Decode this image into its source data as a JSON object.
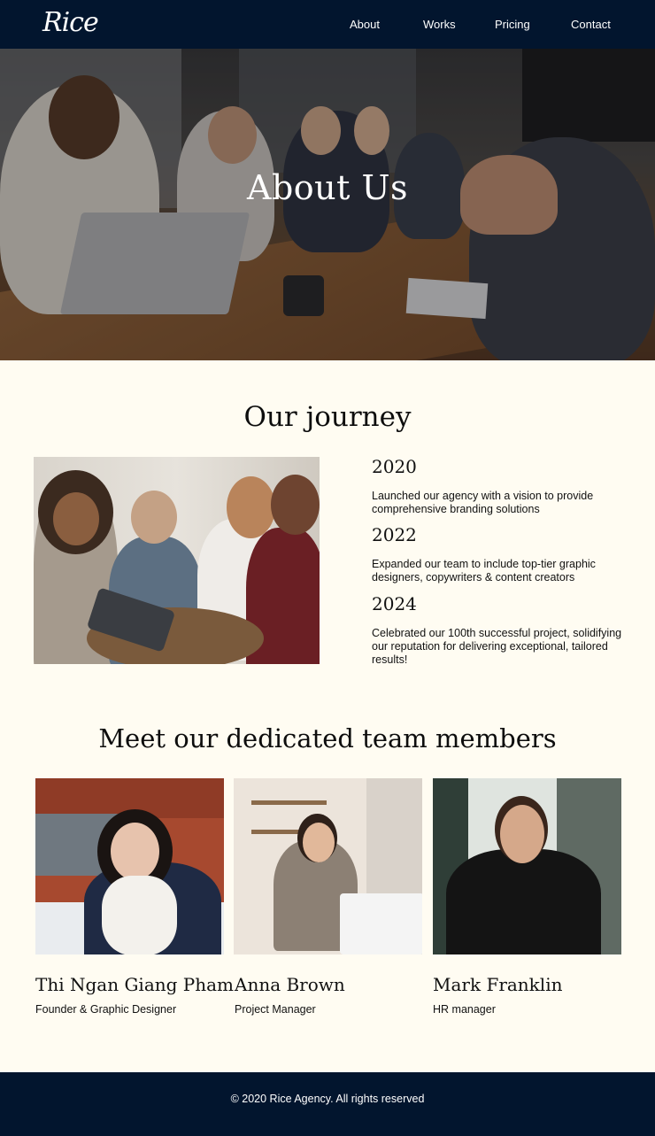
{
  "header": {
    "logo": "Rice",
    "nav": [
      "About",
      "Works",
      "Pricing",
      "Contact"
    ]
  },
  "hero": {
    "title": "About Us"
  },
  "journey": {
    "title": "Our journey",
    "items": [
      {
        "year": "2020",
        "text": "Launched our agency with a vision to provide comprehensive branding solutions"
      },
      {
        "year": "2022",
        "text": "Expanded our team to include top-tier graphic designers, copywriters & content creators"
      },
      {
        "year": "2024",
        "text": "Celebrated our 100th successful project, solidifying our reputation for delivering exceptional, tailored results!"
      }
    ]
  },
  "team": {
    "title": "Meet our dedicated team members",
    "members": [
      {
        "name": "Thi Ngan Giang Pham",
        "role": "Founder & Graphic Designer"
      },
      {
        "name": "Anna Brown",
        "role": "Project Manager"
      },
      {
        "name": "Mark Franklin",
        "role": "HR manager"
      }
    ]
  },
  "footer": {
    "copyright": "© 2020 Rice Agency. All rights reserved"
  },
  "colors": {
    "navy": "#02152e",
    "cream": "#fffcf2"
  }
}
